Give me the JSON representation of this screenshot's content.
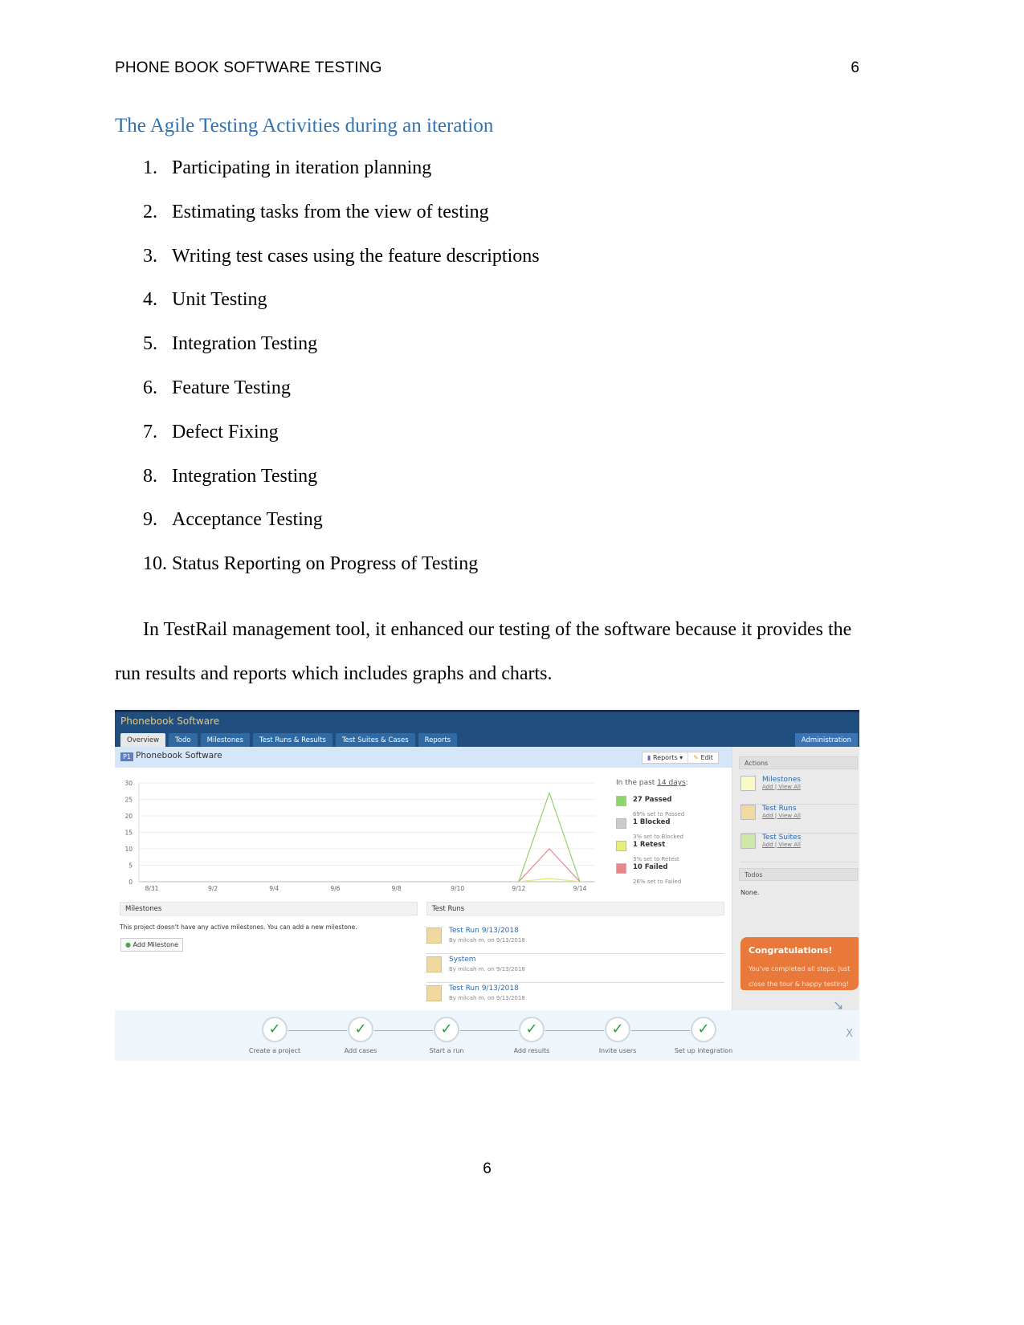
{
  "header": {
    "running_head": "PHONE BOOK SOFTWARE TESTING",
    "page_number": "6"
  },
  "heading": "The Agile Testing Activities during an iteration",
  "list": [
    {
      "n": "1.",
      "text": "Participating in iteration planning"
    },
    {
      "n": "2.",
      "text": "Estimating tasks from the view of testing"
    },
    {
      "n": "3.",
      "text": "Writing test cases using the feature descriptions"
    },
    {
      "n": "4.",
      "text": "Unit Testing"
    },
    {
      "n": "5.",
      "text": "Integration Testing"
    },
    {
      "n": "6.",
      "text": "Feature Testing"
    },
    {
      "n": "7.",
      "text": "Defect Fixing"
    },
    {
      "n": "8.",
      "text": "Integration Testing"
    },
    {
      "n": "9.",
      "text": "Acceptance Testing"
    },
    {
      "n": "10.",
      "text": "Status Reporting on Progress of Testing"
    }
  ],
  "paragraph": {
    "line1": "In TestRail management tool, it enhanced our testing of the software because it provides the",
    "line2": "run results and reports which includes graphs and charts."
  },
  "footer_page": "6",
  "app": {
    "title": "Phonebook Software",
    "tabs": [
      "Overview",
      "Todo",
      "Milestones",
      "Test Runs & Results",
      "Test Suites & Cases",
      "Reports"
    ],
    "admin": "Administration",
    "project_badge": "P1",
    "project_name": "Phonebook Software",
    "reports_btn": "Reports ▾",
    "edit_btn": "Edit",
    "legend_title_pre": "In the past ",
    "legend_title_link": "14 days",
    "legend_title_post": ":",
    "legend": [
      {
        "label": "27 Passed",
        "sub": "69% set to Passed",
        "color": "#8fd36b"
      },
      {
        "label": "1 Blocked",
        "sub": "3% set to Blocked",
        "color": "#cccccc"
      },
      {
        "label": "1 Retest",
        "sub": "3% set to Retest",
        "color": "#e8ec7a"
      },
      {
        "label": "10 Failed",
        "sub": "26% set to Failed",
        "color": "#e8858f"
      }
    ],
    "sidebar": {
      "actions": "Actions",
      "items": [
        {
          "title": "Milestones",
          "add": "Add",
          "view": "View All",
          "color": "#fafac8"
        },
        {
          "title": "Test Runs",
          "add": "Add",
          "view": "View All",
          "color": "#f3d8a0"
        },
        {
          "title": "Test Suites",
          "add": "Add",
          "view": "View All",
          "color": "#cfe8a8"
        }
      ],
      "todos": "Todos",
      "todos_value": "None."
    },
    "congrats": {
      "title": "Congratulations!",
      "text": "You've completed all steps. Just close the tour & happy testing!"
    },
    "milestones": {
      "header": "Milestones",
      "message": "This project doesn't have any active milestones. You can add a new milestone.",
      "add_button": "Add Milestone"
    },
    "test_runs": {
      "header": "Test Runs",
      "items": [
        {
          "title": "Test Run 9/13/2018",
          "sub": "By milcah m. on 9/13/2018"
        },
        {
          "title": "System",
          "sub": "By milcah m. on 9/13/2018"
        },
        {
          "title": "Test Run 9/13/2018",
          "sub": "By milcah m. on 9/13/2018"
        }
      ]
    },
    "tour_steps": [
      "Create a project",
      "Add cases",
      "Start a run",
      "Add results",
      "Invite users",
      "Set up integration"
    ],
    "tour_close": "X"
  },
  "chart_data": {
    "type": "line",
    "x": [
      "8/31",
      "9/1",
      "9/2",
      "9/3",
      "9/4",
      "9/5",
      "9/6",
      "9/7",
      "9/8",
      "9/9",
      "9/10",
      "9/11",
      "9/12",
      "9/13",
      "9/14"
    ],
    "xticks": [
      "8/31",
      "9/2",
      "9/4",
      "9/6",
      "9/8",
      "9/10",
      "9/12",
      "9/14"
    ],
    "yticks": [
      0,
      5,
      10,
      15,
      20,
      25,
      30
    ],
    "ylim": [
      0,
      30
    ],
    "grid": true,
    "series": [
      {
        "name": "Passed",
        "color": "#8fd36b",
        "values": [
          0,
          0,
          0,
          0,
          0,
          0,
          0,
          0,
          0,
          0,
          0,
          0,
          0,
          27,
          0
        ]
      },
      {
        "name": "Failed",
        "color": "#e8858f",
        "values": [
          0,
          0,
          0,
          0,
          0,
          0,
          0,
          0,
          0,
          0,
          0,
          0,
          0,
          10,
          0
        ]
      },
      {
        "name": "Retest",
        "color": "#e8ec7a",
        "values": [
          0,
          0,
          0,
          0,
          0,
          0,
          0,
          0,
          0,
          0,
          0,
          0,
          0,
          1,
          0
        ]
      },
      {
        "name": "Blocked",
        "color": "#cccccc",
        "values": [
          0,
          0,
          0,
          0,
          0,
          0,
          0,
          0,
          0,
          0,
          0,
          0,
          0,
          1,
          0
        ]
      }
    ],
    "legend": "right"
  }
}
